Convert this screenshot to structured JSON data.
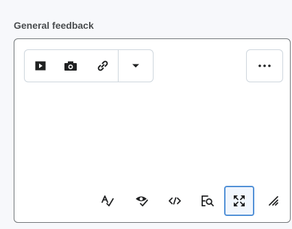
{
  "field": {
    "label": "General feedback"
  },
  "toolbar": {
    "buttons": [
      {
        "name": "insert-media-button",
        "icon": "play-icon"
      },
      {
        "name": "insert-image-button",
        "icon": "camera-icon"
      },
      {
        "name": "insert-link-button",
        "icon": "link-icon"
      },
      {
        "name": "insert-dropdown-button",
        "icon": "caret-down-icon"
      }
    ],
    "more": {
      "icon": "more-horizontal-icon"
    }
  },
  "bottom_toolbar": {
    "buttons": [
      {
        "name": "spellcheck-button",
        "icon": "spellcheck-icon"
      },
      {
        "name": "accessibility-check-button",
        "icon": "accessibility-check-icon"
      },
      {
        "name": "source-code-button",
        "icon": "code-icon"
      },
      {
        "name": "preview-button",
        "icon": "preview-icon"
      },
      {
        "name": "fullscreen-button",
        "icon": "fullscreen-icon",
        "active": true
      },
      {
        "name": "resize-handle",
        "icon": "resize-icon"
      }
    ]
  },
  "colors": {
    "icon": "#202122",
    "border": "#cdd5dc",
    "editor_border": "#6e7376",
    "active_border": "#4f8fd6",
    "background": "#f7f8fb"
  }
}
